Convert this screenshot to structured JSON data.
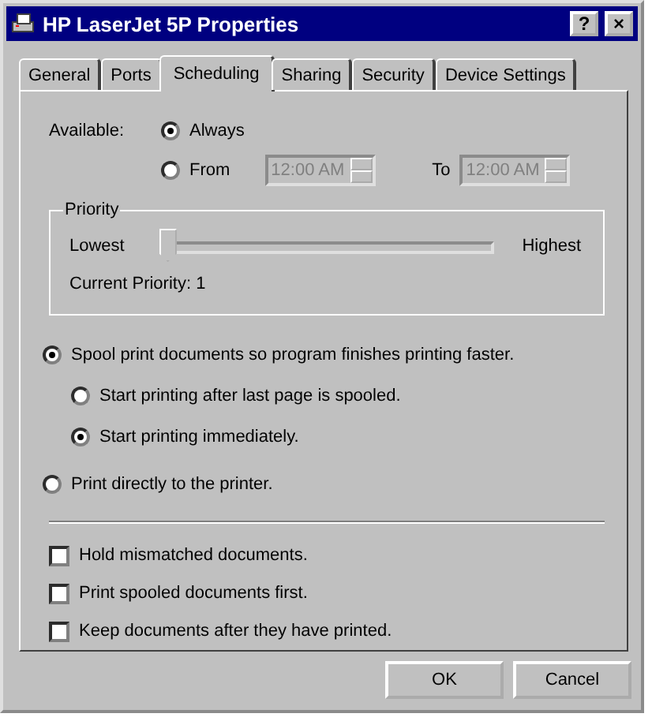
{
  "window": {
    "title": "HP LaserJet 5P Properties",
    "title_buttons": [
      "?",
      "×"
    ]
  },
  "tabs": [
    {
      "label": "General",
      "selected": false
    },
    {
      "label": "Ports",
      "selected": false
    },
    {
      "label": "Scheduling",
      "selected": true
    },
    {
      "label": "Sharing",
      "selected": false
    },
    {
      "label": "Security",
      "selected": false
    },
    {
      "label": "Device Settings",
      "selected": false
    }
  ],
  "availability": {
    "label": "Available:",
    "options": [
      {
        "label": "Always",
        "selected": true
      },
      {
        "label": "From",
        "selected": false
      }
    ],
    "from": {
      "value": "12:00 AM",
      "disabled": true
    },
    "to_label": "To",
    "to": {
      "value": "12:00 AM",
      "disabled": true
    }
  },
  "priority": {
    "title": "Priority",
    "low_label": "Lowest",
    "high_label": "Highest",
    "level": 0,
    "current": "Current Priority:  1"
  },
  "spool_options": [
    {
      "label": "Spool print documents so program finishes printing faster.",
      "selected": true,
      "children": [
        {
          "label": "Start printing after last page is spooled.",
          "selected": false
        },
        {
          "label": "Start printing immediately.",
          "selected": true
        }
      ]
    },
    {
      "label": "Print directly to the printer.",
      "selected": false
    }
  ],
  "checkboxes": [
    {
      "label": "Hold mismatched documents.",
      "checked": false
    },
    {
      "label": "Print spooled documents first.",
      "checked": false
    },
    {
      "label": "Keep documents after they have printed.",
      "checked": false
    }
  ],
  "buttons": [
    "OK",
    "Cancel"
  ]
}
